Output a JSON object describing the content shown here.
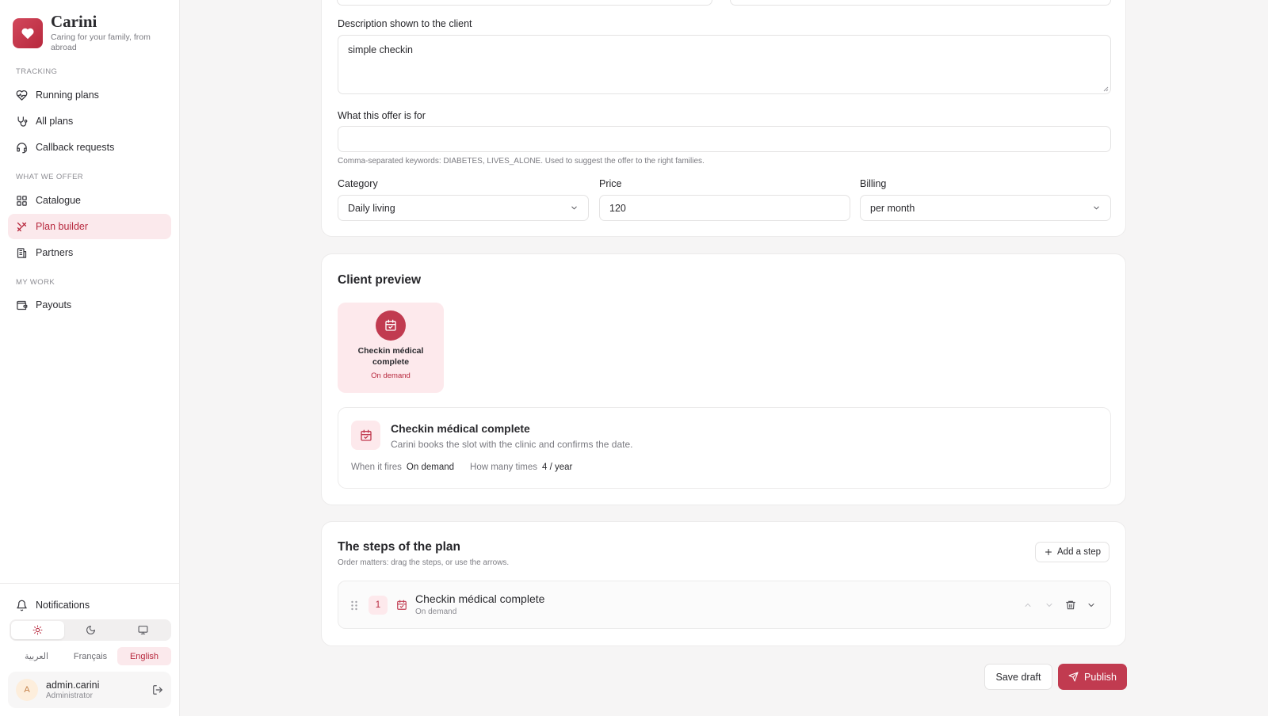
{
  "brand": {
    "name": "Carini",
    "tagline": "Caring for your family, from abroad"
  },
  "sidebar": {
    "sections": [
      {
        "label": "TRACKING",
        "items": [
          {
            "label": "Running plans",
            "icon": "heart-pulse-icon"
          },
          {
            "label": "All plans",
            "icon": "stethoscope-icon"
          },
          {
            "label": "Callback requests",
            "icon": "headset-icon"
          }
        ]
      },
      {
        "label": "WHAT WE OFFER",
        "items": [
          {
            "label": "Catalogue",
            "icon": "grid-icon"
          },
          {
            "label": "Plan builder",
            "icon": "tools-icon",
            "active": true
          },
          {
            "label": "Partners",
            "icon": "building-icon"
          }
        ]
      },
      {
        "label": "MY WORK",
        "items": [
          {
            "label": "Payouts",
            "icon": "wallet-icon"
          }
        ]
      }
    ],
    "notifications_label": "Notifications",
    "languages": [
      "العربية",
      "Français",
      "English"
    ],
    "active_language": "English",
    "user": {
      "initial": "A",
      "name": "admin.carini",
      "role": "Administrator"
    }
  },
  "form": {
    "description_label": "Description shown to the client",
    "description_value": "simple checkin",
    "offer_for_label": "What this offer is for",
    "offer_for_value": "",
    "offer_for_hint": "Comma-separated keywords: DIABETES, LIVES_ALONE. Used to suggest the offer to the right families.",
    "category_label": "Category",
    "category_value": "Daily living",
    "price_label": "Price",
    "price_value": "120",
    "billing_label": "Billing",
    "billing_value": "per month"
  },
  "preview": {
    "title": "Client preview",
    "tile_name": "Checkin médical complete",
    "tile_sub": "On demand",
    "detail_title": "Checkin médical complete",
    "detail_sub": "Carini books the slot with the clinic and confirms the date.",
    "when_label": "When it fires",
    "when_value": "On demand",
    "times_label": "How many times",
    "times_value": "4 / year"
  },
  "steps": {
    "title": "The steps of the plan",
    "subtitle": "Order matters: drag the steps, or use the arrows.",
    "add_label": "Add a step",
    "items": [
      {
        "number": "1",
        "title": "Checkin médical complete",
        "sub": "On demand"
      }
    ]
  },
  "actions": {
    "save_draft": "Save draft",
    "publish": "Publish"
  },
  "colors": {
    "accent": "#c13b50",
    "accent_soft": "#fde9ec"
  }
}
